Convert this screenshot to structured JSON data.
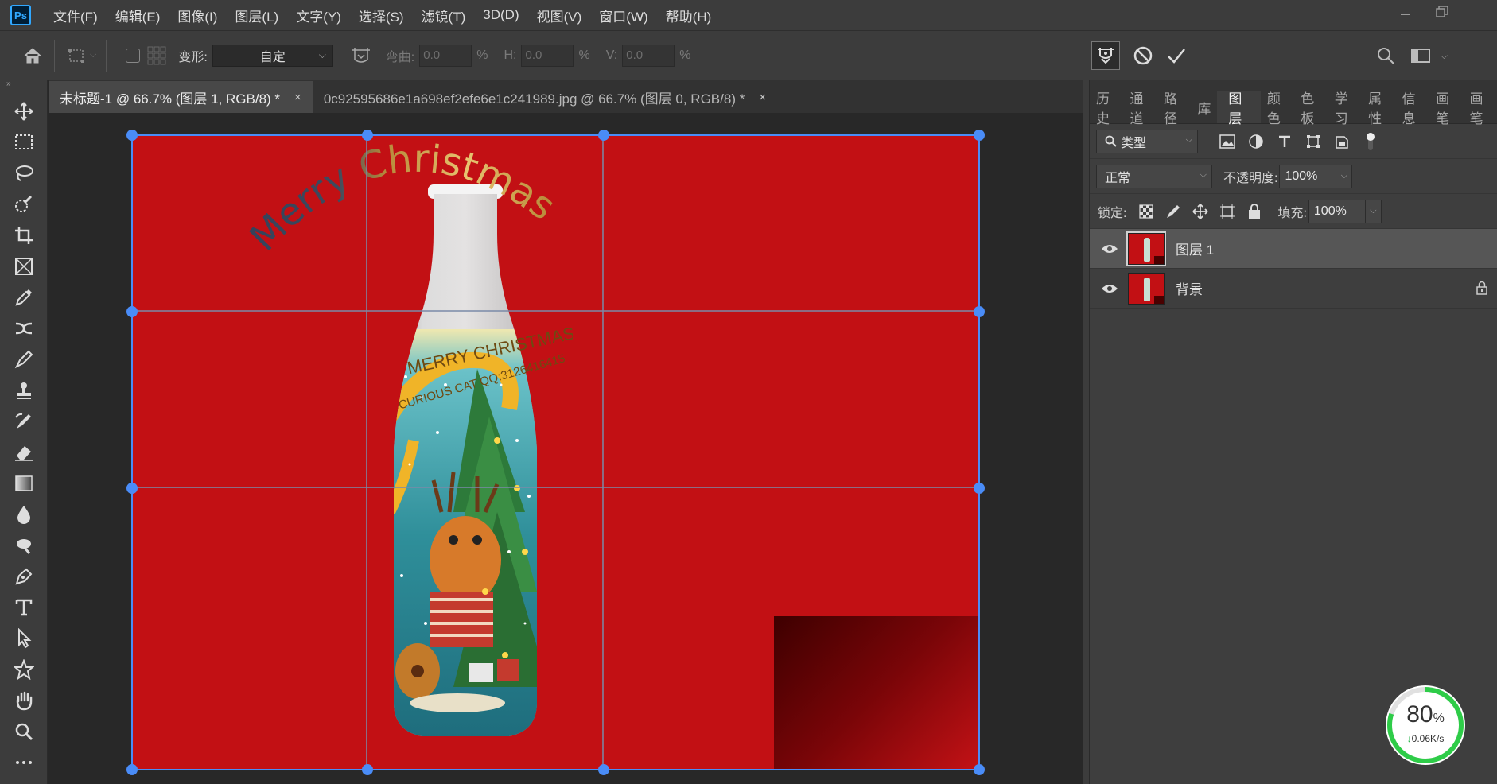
{
  "app": {
    "logo": "Ps"
  },
  "menu": [
    "文件(F)",
    "编辑(E)",
    "图像(I)",
    "图层(L)",
    "文字(Y)",
    "选择(S)",
    "滤镜(T)",
    "3D(D)",
    "视图(V)",
    "窗口(W)",
    "帮助(H)"
  ],
  "options": {
    "transform_label": "变形:",
    "transform_value": "自定",
    "bend_label": "弯曲:",
    "bend_value": "0.0",
    "h_label": "H:",
    "h_value": "0.0",
    "v_label": "V:",
    "v_value": "0.0",
    "percent": "%"
  },
  "tabs": [
    {
      "title": "未标题-1 @ 66.7% (图层 1, RGB/8) *",
      "close": "×"
    },
    {
      "title": "0c92595686e1a698ef2efe6e1c241989.jpg @ 66.7% (图层 0, RGB/8) *",
      "close": "×"
    }
  ],
  "canvas": {
    "curved_text": "Merry Christmas",
    "label_line1": "MERRY CHRISTMAS",
    "label_line2": "CURIOUS CAT QQ:3126416415",
    "background_color": "#c21014"
  },
  "panel": {
    "tabs": [
      "历史",
      "通道",
      "路径",
      "库",
      "图层",
      "颜色",
      "色板",
      "学习",
      "属性",
      "信息",
      "画笔",
      "画笔"
    ],
    "active_tab": "图层",
    "filter_kind": "类型",
    "blend_mode": "正常",
    "opacity_label": "不透明度:",
    "opacity_value": "100%",
    "lock_label": "锁定:",
    "fill_label": "填充:",
    "fill_value": "100%",
    "layers": [
      {
        "name": "图层 1",
        "visible": true,
        "selected": true,
        "locked": false
      },
      {
        "name": "背景",
        "visible": true,
        "selected": false,
        "locked": true
      }
    ]
  },
  "network": {
    "percent": "80",
    "percent_sign": "%",
    "speed": "0.06K/s",
    "arrow": "↓",
    "progress": 0.8
  },
  "colors": {
    "accent": "#4a8cf7",
    "canvas_red": "#c21014",
    "ps_blue": "#31a8ff"
  }
}
